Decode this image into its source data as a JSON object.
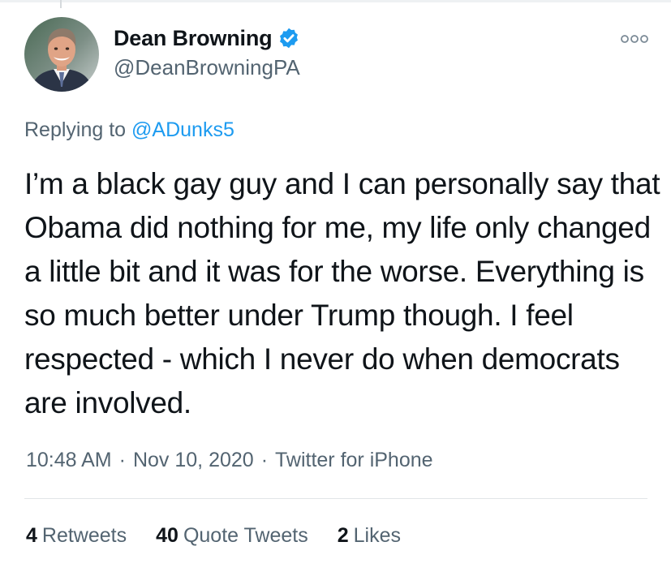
{
  "tweet": {
    "author": {
      "display_name": "Dean Browning",
      "handle": "@DeanBrowningPA",
      "verified": true,
      "avatar_icon": "profile-photo"
    },
    "more_icon": "more-options-icon",
    "replying_to": {
      "prefix": "Replying to",
      "mention": "@ADunks5"
    },
    "text": "I’m a black gay guy and I can personally say that Obama did nothing for me, my life only changed a little bit and it was for the worse. Everything is so much better under Trump though. I feel respected - which I never do when democrats are involved.",
    "meta": {
      "time": "10:48 AM",
      "date": "Nov 10, 2020",
      "source": "Twitter for iPhone",
      "separator": "·"
    },
    "stats": {
      "retweets": {
        "count": "4",
        "label": "Retweets"
      },
      "quote_tweets": {
        "count": "40",
        "label": "Quote Tweets"
      },
      "likes": {
        "count": "2",
        "label": "Likes"
      }
    }
  },
  "colors": {
    "text_primary": "#0f1419",
    "text_secondary": "#536471",
    "link": "#1d9bf0",
    "verified_badge": "#1d9bf0"
  }
}
